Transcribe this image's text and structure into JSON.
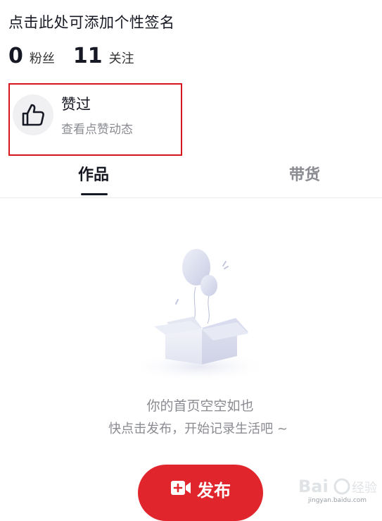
{
  "profile": {
    "signature_prompt": "点击此处可添加个性签名",
    "stats": [
      {
        "value": "0",
        "label": "粉丝"
      },
      {
        "value": "11",
        "label": "关注"
      }
    ]
  },
  "liked": {
    "title": "赞过",
    "subtitle": "查看点赞动态",
    "highlight_color": "#d7161e"
  },
  "tabs": [
    {
      "label": "作品",
      "active": true
    },
    {
      "label": "带货",
      "active": false
    }
  ],
  "empty_state": {
    "title": "你的首页空空如也",
    "subtitle": "快点击发布，开始记录生活吧 ~"
  },
  "publish": {
    "label": "发布",
    "color": "#e0262c"
  },
  "watermark": {
    "text": "jingyan.baidu.com"
  }
}
